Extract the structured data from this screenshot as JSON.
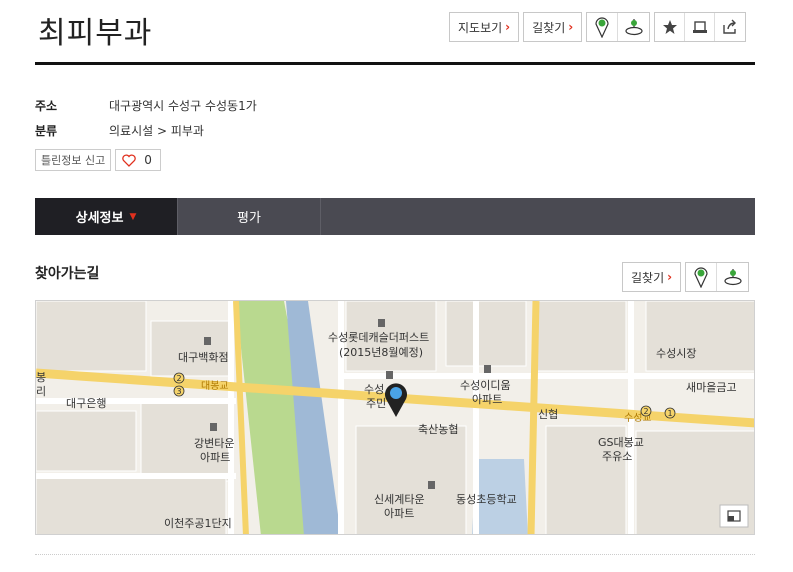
{
  "place": {
    "title": "최피부과"
  },
  "top_actions": {
    "map_view_label": "지도보기",
    "directions_label": "길찾기"
  },
  "info": {
    "address_label": "주소",
    "address_value": "대구광역시 수성구 수성동1가",
    "category_label": "분류",
    "category_value": "의료시설 > 피부과"
  },
  "report": {
    "label": "틀린정보 신고",
    "like_count": "0"
  },
  "tabs": [
    {
      "label": "상세정보"
    },
    {
      "label": "평가"
    }
  ],
  "directions_section": {
    "title": "찾아가는길",
    "directions_label": "길찾기"
  },
  "map": {
    "labels": {
      "dept_store": "대구백화점",
      "bank": "대구은행",
      "gangbyeon": "강변타운",
      "apartment": "아파트",
      "icheon": "이천주공1단지",
      "lotte": "수성롯데캐슬더퍼스트",
      "lotte_sub": "(2015년8월예정)",
      "suseong_idium": "수성이디움",
      "suseong_market": "수성시장",
      "saemaeul": "새마을금고",
      "shinhyup": "신협",
      "chuksan": "축산농협",
      "gs": "GS대봉교",
      "gs_sub": "주유소",
      "shinsegye": "신세계타운",
      "dongseong": "동성초등학교",
      "daebong_road": "대봉교",
      "suseong_road": "수성교",
      "suseong_partial": "수성",
      "jumin_partial": "주민",
      "edge_a": "봉",
      "edge_b": "리"
    }
  },
  "colors": {
    "accent": "#e0301e",
    "tab_bg": "#4a4a52",
    "tab_active": "#1f1f24",
    "road": "#f5d36a"
  }
}
